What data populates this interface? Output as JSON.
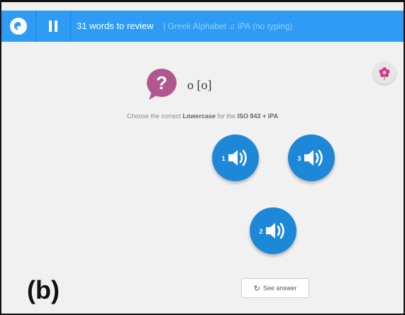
{
  "header": {
    "review_text": "31 words to review",
    "course_text": "| Greek Alphabet ♫ IPA (no typing)"
  },
  "question": {
    "prompt": "o [o]",
    "instruction_prefix": "Choose the correct ",
    "instruction_field": "Lowercase",
    "instruction_mid": " for the ",
    "instruction_source": "ISO 843 + IPA"
  },
  "choices": [
    {
      "number": "1"
    },
    {
      "number": "3"
    },
    {
      "number": "2"
    }
  ],
  "see_answer_label": "See answer",
  "figure_label": "(b)",
  "colors": {
    "topbar": "#2e9cf4",
    "choice": "#1e88d8",
    "question_bubble": "#b1578f"
  }
}
